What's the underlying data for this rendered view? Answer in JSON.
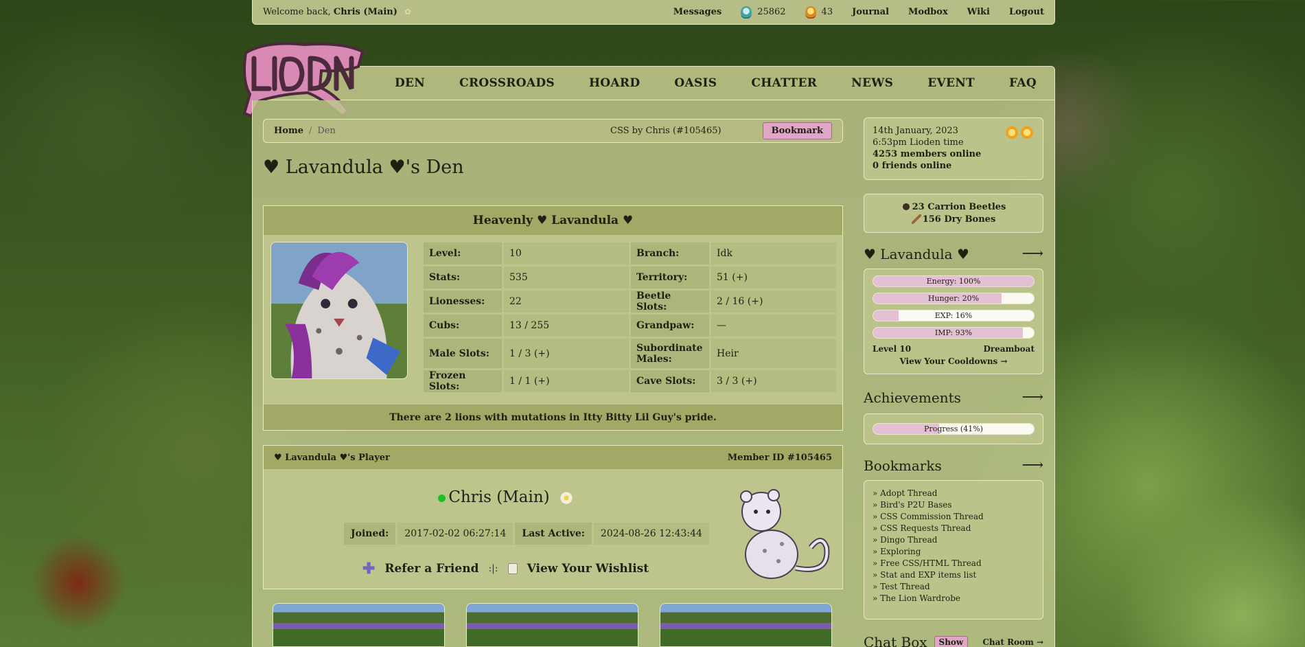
{
  "topbar": {
    "welcome_prefix": "Welcome back,",
    "user_name": "Chris (Main)",
    "messages": "Messages",
    "gold_count": "25862",
    "gb_count": "43",
    "journal": "Journal",
    "modbox": "Modbox",
    "wiki": "Wiki",
    "logout": "Logout"
  },
  "nav": [
    "DEN",
    "CROSSROADS",
    "HOARD",
    "OASIS",
    "CHATTER",
    "NEWS",
    "EVENT",
    "FAQ"
  ],
  "breadcrumb": {
    "home": "Home",
    "separator": "/",
    "current": "Den",
    "css_credit": "CSS by Chris (#105465)",
    "bookmark": "Bookmark"
  },
  "page_title": "♥ Lavandula ♥'s Den",
  "lion": {
    "name": "Heavenly ♥ Lavandula ♥",
    "stats": [
      {
        "label": "Level:",
        "value": "10"
      },
      {
        "label": "Branch:",
        "value": "Idk"
      },
      {
        "label": "Stats:",
        "value": "535"
      },
      {
        "label": "Territory:",
        "value": "51 (+)"
      },
      {
        "label": "Lionesses:",
        "value": "22"
      },
      {
        "label": "Beetle Slots:",
        "value": "2 / 16 (+)"
      },
      {
        "label": "Cubs:",
        "value": "13 / 255"
      },
      {
        "label": "Grandpaw:",
        "value": "—"
      },
      {
        "label": "Male Slots:",
        "value": "1 / 3 (+)"
      },
      {
        "label": "Subordinate Males:",
        "value": "Heir"
      },
      {
        "label": "Frozen Slots:",
        "value": "1 / 1 (+)"
      },
      {
        "label": "Cave Slots:",
        "value": "3 / 3 (+)"
      }
    ],
    "mutation_note": "There are 2 lions with mutations in Itty Bitty Lil Guy's pride."
  },
  "player": {
    "header_title": "♥ Lavandula ♥'s Player",
    "member_id": "Member ID #105465",
    "name": "Chris (Main)",
    "joined_label": "Joined:",
    "joined_value": "2017-02-02 06:27:14",
    "active_label": "Last Active:",
    "active_value": "2024-08-26 12:43:44",
    "refer": "Refer a Friend",
    "divider": ":|:",
    "wishlist": "View Your Wishlist"
  },
  "sidebar": {
    "date": "14th January, 2023",
    "time": "6:53pm Lioden time",
    "members_online": "4253 members online",
    "friends_online": "0 friends online",
    "beetles": "23 Carrion Beetles",
    "bones": "156 Dry Bones",
    "lion_heading": "♥ Lavandula ♥",
    "bars": [
      {
        "label": "Energy: 100%",
        "value": 1.0
      },
      {
        "label": "Hunger: 20%",
        "value": 0.8
      },
      {
        "label": "EXP: 16%",
        "value": 0.16
      },
      {
        "label": "IMP: 93%",
        "value": 0.93
      }
    ],
    "level": "Level 10",
    "title": "Dreamboat",
    "cooldowns": "View Your Cooldowns →",
    "achievements_heading": "Achievements",
    "achievements_progress_label": "Progress (41%)",
    "achievements_progress": 0.41,
    "bookmarks_heading": "Bookmarks",
    "bookmarks": [
      "» Adopt Thread",
      "» Bird's P2U Bases",
      "» CSS Commission Thread",
      "» CSS Requests Thread",
      "» Dingo Thread",
      "» Exploring",
      "» Free CSS/HTML Thread",
      "» Stat and EXP items list",
      "» Test Thread",
      "» The Lion Wardrobe"
    ],
    "chat_heading": "Chat Box",
    "chat_show": "Show",
    "chat_room": "Chat Room →"
  },
  "colors": {
    "panel": "#bec58c",
    "header": "#a2a966",
    "accent_pink": "#dfa6c6",
    "online": "#19c21f"
  }
}
